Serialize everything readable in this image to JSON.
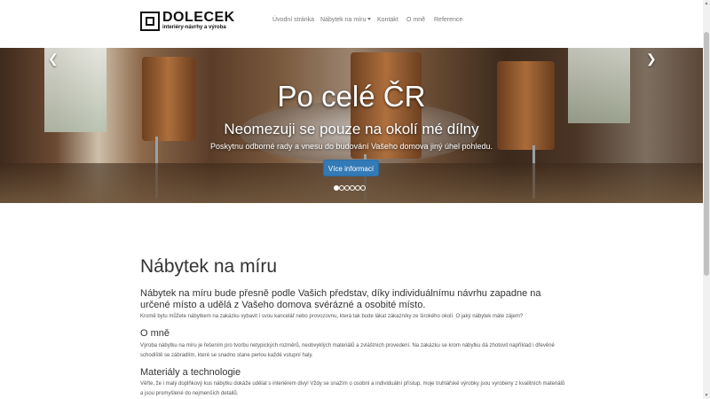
{
  "brand": {
    "name": "DOLECEK",
    "tagline": "interiéry-návrhy a výroba"
  },
  "nav": {
    "items": [
      {
        "label": "Úvodní stránka"
      },
      {
        "label": "Nábytek na míru",
        "dropdown": true
      },
      {
        "label": "Kontakt"
      },
      {
        "label": "O mně"
      },
      {
        "label": "Reference"
      }
    ]
  },
  "carousel": {
    "title": "Po celé ČR",
    "subtitle": "Neomezuji se pouze na okolí mé dílny",
    "text": "Poskytnu odborné rady a vnesu do budování Vašeho domova jiný úhel pohledu.",
    "button": "Více informací",
    "slides": 6,
    "active_slide": 1,
    "prev_icon": "chevron-left-icon",
    "next_icon": "chevron-right-icon"
  },
  "main": {
    "title": "Nábytek na míru",
    "lead": "Nábytek na míru bude přesně podle Vašich představ, díky individuálnímu návrhu zapadne na určené místo a udělá z Vašeho domova svérázné a osobité místo.",
    "intro": "Kromě bytu můžete nábytkem na zakázku vybavit i svou kancelář nebo provozovnu, která tak bude lákat zákazníky ze širokého okolí. O jaký nábytek máte zájem?",
    "sections": [
      {
        "heading": "O mně",
        "text": "Výroba nábytku na míru je řešením pro tvorbu netypických rozměrů, neobvyklých materiálů a zvláštních provedení. Na zakázku se krom nábytku dá zhotovit například i dřevěné schodiště se zábradlím, které se snadno stane perlou každé vstupní haly."
      },
      {
        "heading": "Materiály a technologie",
        "text": "Věřte, že i malý doplňkový kus nábytku dokáže udělat s interiérem divy! Vždy se snažím o osobní a individuální přístup, moje truhlářské výrobky jsou vyrobeny z kvalitních materiálů a jsou promyšlené do nejmenších detailů."
      }
    ]
  },
  "colors": {
    "primary": "#337ab7",
    "navbar_bg": "#ffffff",
    "nav_text": "#777777"
  }
}
